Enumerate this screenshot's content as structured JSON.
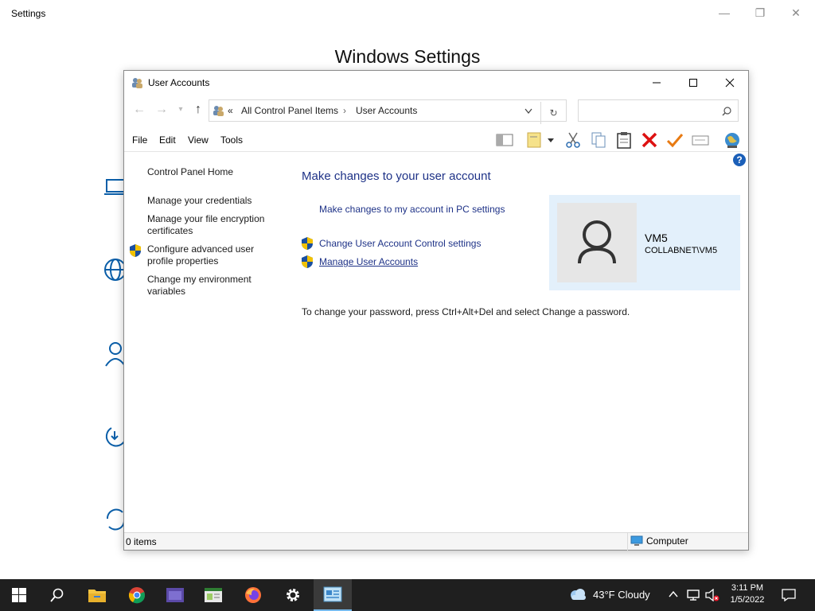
{
  "settings": {
    "title": "Settings",
    "heading": "Windows Settings"
  },
  "window": {
    "title": "User Accounts",
    "breadcrumb": {
      "prefix": "«",
      "items": [
        "All Control Panel Items",
        "User Accounts"
      ]
    },
    "search_placeholder": "",
    "menu": [
      "File",
      "Edit",
      "View",
      "Tools"
    ],
    "left_links": [
      "Control Panel Home",
      "Manage your credentials",
      "Manage your file encryption certificates",
      "Configure advanced user profile properties",
      "Change my environment variables"
    ],
    "main": {
      "title": "Make changes to your user account",
      "links": [
        "Make changes to my account in PC settings",
        "Change User Account Control settings",
        "Manage User Accounts"
      ],
      "note": "To change your password, press Ctrl+Alt+Del and select Change a password."
    },
    "account": {
      "name": "VM5",
      "domain": "COLLABNET\\VM5"
    },
    "status": {
      "items": "0 items",
      "location": "Computer"
    }
  },
  "taskbar": {
    "weather": "43°F  Cloudy",
    "time": "3:11 PM",
    "date": "1/5/2022"
  },
  "colors": {
    "link": "#1e3287",
    "accent": "#1b5fb8",
    "card": "#e3f0fb",
    "taskbar": "#1f1f1f"
  }
}
